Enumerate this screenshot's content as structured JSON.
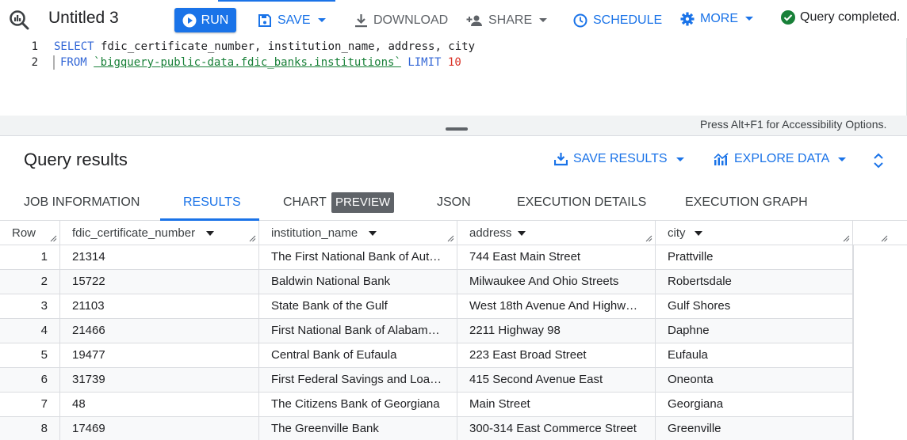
{
  "toolbar": {
    "tab_title": "Untitled 3",
    "run_label": "RUN",
    "save_label": "SAVE",
    "download_label": "DOWNLOAD",
    "share_label": "SHARE",
    "schedule_label": "SCHEDULE",
    "more_label": "MORE",
    "status_text": "Query completed."
  },
  "editor": {
    "line_numbers": [
      "1",
      "2"
    ],
    "line1": {
      "keyword": "SELECT",
      "columns": " fdic_certificate_number, institution_name, address, city"
    },
    "line2": {
      "keyword": "FROM",
      "table": "`bigquery-public-data.fdic_banks.institutions`",
      "limit_keyword": "LIMIT",
      "limit_value": "10"
    },
    "accessibility_hint": "Press Alt+F1 for Accessibility Options."
  },
  "results": {
    "title": "Query results",
    "save_results_label": "SAVE RESULTS",
    "explore_data_label": "EXPLORE DATA",
    "tabs": [
      {
        "label": "JOB INFORMATION"
      },
      {
        "label": "RESULTS"
      },
      {
        "label": "CHART"
      },
      {
        "label": "JSON"
      },
      {
        "label": "EXECUTION DETAILS"
      },
      {
        "label": "EXECUTION GRAPH"
      }
    ],
    "active_tab": "RESULTS",
    "chart_badge": "PREVIEW"
  },
  "table": {
    "columns": [
      "Row",
      "fdic_certificate_number",
      "institution_name",
      "address",
      "city"
    ],
    "rows": [
      [
        "1",
        "21314",
        "The First National Bank of Aut…",
        "744 East Main Street",
        "Prattville"
      ],
      [
        "2",
        "15722",
        "Baldwin National Bank",
        "Milwaukee And Ohio Streets",
        "Robertsdale"
      ],
      [
        "3",
        "21103",
        "State Bank of the Gulf",
        "West 18th Avenue And Highwa…",
        "Gulf Shores"
      ],
      [
        "4",
        "21466",
        "First National Bank of Alabama…",
        "2211 Highway 98",
        "Daphne"
      ],
      [
        "5",
        "19477",
        "Central Bank of Eufaula",
        "223 East Broad Street",
        "Eufaula"
      ],
      [
        "6",
        "31739",
        "First Federal Savings and Loan …",
        "415 Second Avenue East",
        "Oneonta"
      ],
      [
        "7",
        "48",
        "The Citizens Bank of Georgiana",
        "Main Street",
        "Georgiana"
      ],
      [
        "8",
        "17469",
        "The Greenville Bank",
        "300-314 East Commerce Street",
        "Greenville"
      ]
    ]
  },
  "icons": {
    "query": "query-magnifier-icon",
    "run": "play-circle-icon",
    "save": "save-icon",
    "download": "download-icon",
    "share": "person-add-icon",
    "schedule": "clock-icon",
    "more": "gear-icon",
    "status": "check-circle-icon",
    "save_results": "download-icon",
    "explore_data": "chart-icon",
    "expand": "unfold-icon"
  },
  "colors": {
    "accent": "#1a73e8",
    "success": "#188038",
    "keyword": "#3367d6",
    "number": "#d93025",
    "badge": "#5f6368"
  }
}
